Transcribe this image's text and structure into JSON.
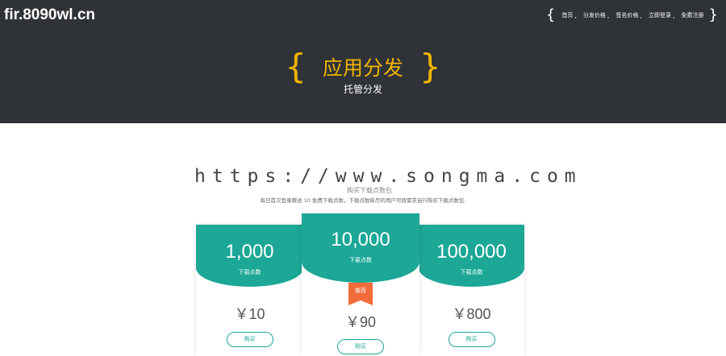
{
  "header": {
    "site_title": "fir.8090wl.cn",
    "nav_open": "{",
    "nav_close": "}",
    "nav_items": [
      {
        "label": "首页"
      },
      {
        "label": "分发价格"
      },
      {
        "label": "签名价格"
      },
      {
        "label": "立即登录"
      },
      {
        "label": "免费注册"
      }
    ],
    "nav_sep": ","
  },
  "hero": {
    "brace_left": "{",
    "brace_right": "}",
    "title": "应用分发",
    "subtitle": "托管分发"
  },
  "watermark": "https://www.songma.com",
  "section_partial_heading": "购买下载点数包",
  "description": "每日首次登录赠送 10 免费下载点数，下载点数耗尽的用户可按需求自行购买下载点数包.",
  "plans": [
    {
      "amount": "1,000",
      "unit": "下载点数",
      "price": "￥10",
      "buy": "购买"
    },
    {
      "amount": "10,000",
      "unit": "下载点数",
      "price": "￥90",
      "buy": "购买",
      "badge": "推荐"
    },
    {
      "amount": "100,000",
      "unit": "下载点数",
      "price": "￥800",
      "buy": "购买"
    }
  ],
  "colors": {
    "header_bg": "#2f3236",
    "accent_gold": "#f0b400",
    "teal": "#1ca797",
    "badge_orange": "#f26b3a"
  }
}
